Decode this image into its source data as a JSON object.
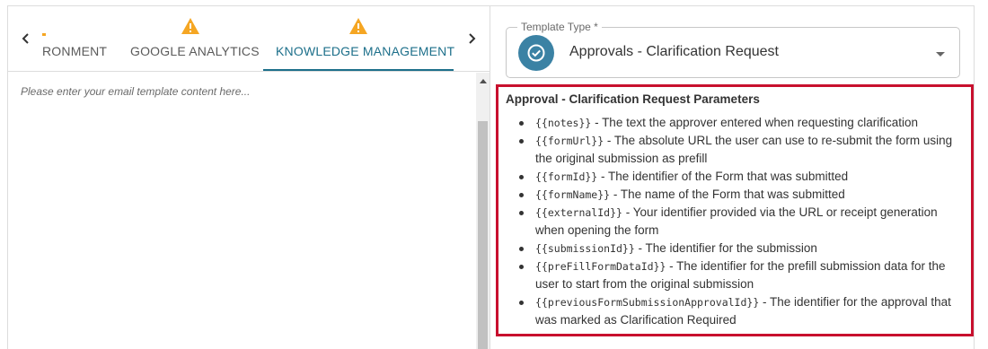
{
  "tabs": {
    "env_label": "RONMENT",
    "ga_label": "GOOGLE ANALYTICS",
    "km_label": "KNOWLEDGE MANAGEMENT",
    "warning_color": "#f5a623",
    "active_color": "#1c6f8a"
  },
  "editor": {
    "placeholder": "Please enter your email template content here..."
  },
  "template_type": {
    "label": "Template Type *",
    "value": "Approvals - Clarification Request",
    "icon": "check-circle-icon",
    "icon_color": "#3b82a4"
  },
  "params": {
    "title": "Approval - Clarification Request Parameters",
    "border_color": "#c8102e",
    "items": [
      {
        "code": "{{notes}}",
        "text": " - The text the approver entered when requesting clarification"
      },
      {
        "code": "{{formUrl}}",
        "text": " - The absolute URL the user can use to re-submit the form using the original submission as prefill"
      },
      {
        "code": "{{formId}}",
        "text": " - The identifier of the Form that was submitted"
      },
      {
        "code": "{{formName}}",
        "text": " - The name of the Form that was submitted"
      },
      {
        "code": "{{externalId}}",
        "text": " - Your identifier provided via the URL or receipt generation when opening the form"
      },
      {
        "code": "{{submissionId}}",
        "text": " - The identifier for the submission"
      },
      {
        "code": "{{preFillFormDataId}}",
        "text": " - The identifier for the prefill submission data for the user to start from the original submission"
      },
      {
        "code": "{{previousFormSubmissionApprovalId}}",
        "text": " - The identifier for the approval that was marked as Clarification Required"
      }
    ]
  }
}
